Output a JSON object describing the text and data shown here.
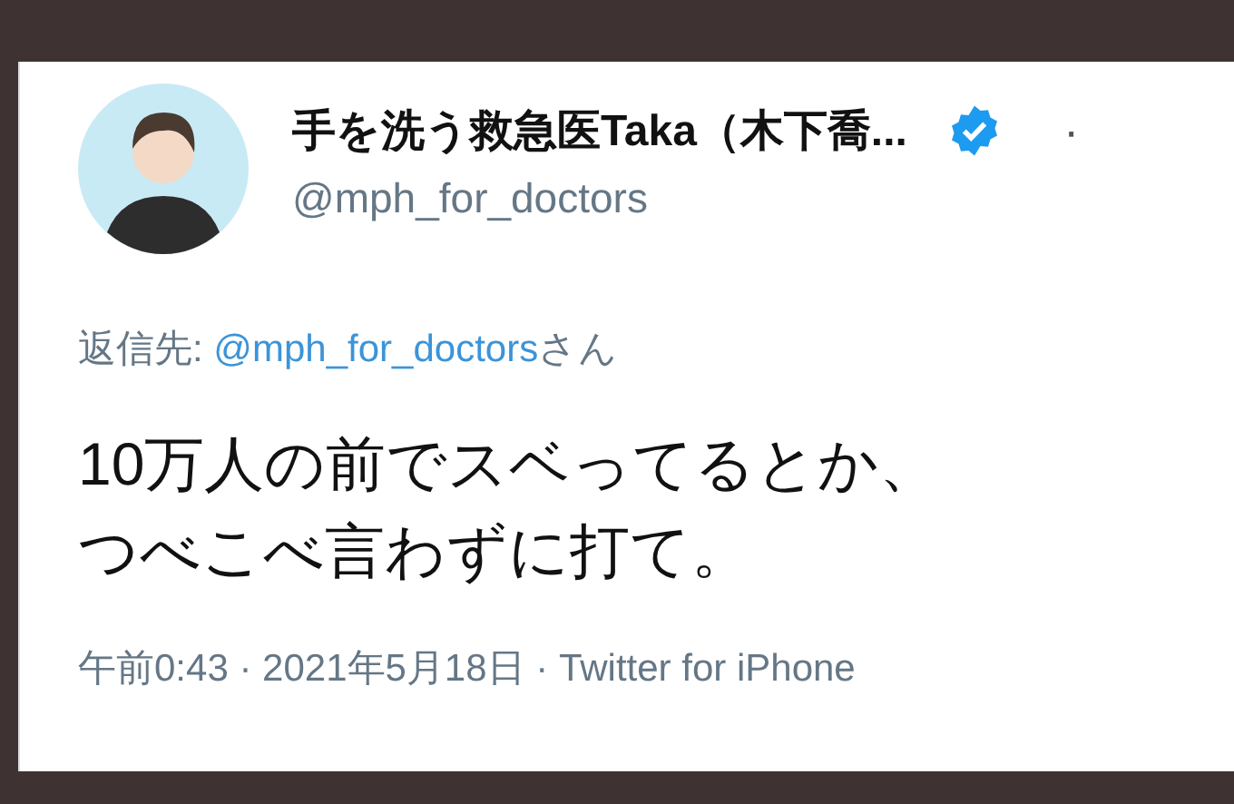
{
  "author": {
    "name": "手を洗う救急医Taka（木下喬...",
    "handle": "@mph_for_doctors",
    "verified": true,
    "more": "·"
  },
  "reply_to": {
    "prefix": "返信先: ",
    "handle": "@mph_for_doctors",
    "suffix": "さん"
  },
  "text_lines": [
    "10万人の前でスベってるとか、",
    "つべこべ言わずに打て。"
  ],
  "footer": "午前0:43 · 2021年5月18日 · Twitter for iPhone"
}
